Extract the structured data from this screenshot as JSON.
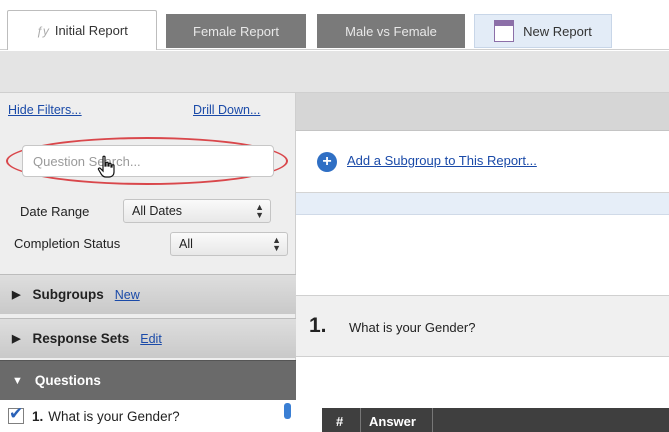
{
  "tabs": [
    {
      "label": "Initial Report",
      "icon": "chart-icon",
      "active": true
    },
    {
      "label": "Female Report",
      "active": false
    },
    {
      "label": "Male vs Female",
      "active": false
    },
    {
      "label": "New Report",
      "icon": "new-report-icon",
      "active": false
    }
  ],
  "filters": {
    "hide_filters": "Hide Filters...",
    "drill_down": "Drill Down...",
    "search_placeholder": "Question Search...",
    "date_range_label": "Date Range",
    "date_range_value": "All Dates",
    "completion_label": "Completion Status",
    "completion_value": "All"
  },
  "sections": {
    "subgroups": {
      "label": "Subgroups",
      "link": "New"
    },
    "response_sets": {
      "label": "Response Sets",
      "link": "Edit"
    },
    "questions": {
      "label": "Questions"
    }
  },
  "question_list": [
    {
      "number": "1.",
      "text": "What is your Gender?",
      "checked": true
    }
  ],
  "main": {
    "add_subgroup": "Add a Subgroup to This Report...",
    "question_number": "1.",
    "question_text": "What is your Gender?",
    "table_headers": [
      "#",
      "Answer"
    ]
  },
  "colors": {
    "link": "#1a4aa8",
    "highlight_ellipse": "#d9474b",
    "dark_tab": "#7a7a7a",
    "questions_header": "#6a6a6a"
  }
}
